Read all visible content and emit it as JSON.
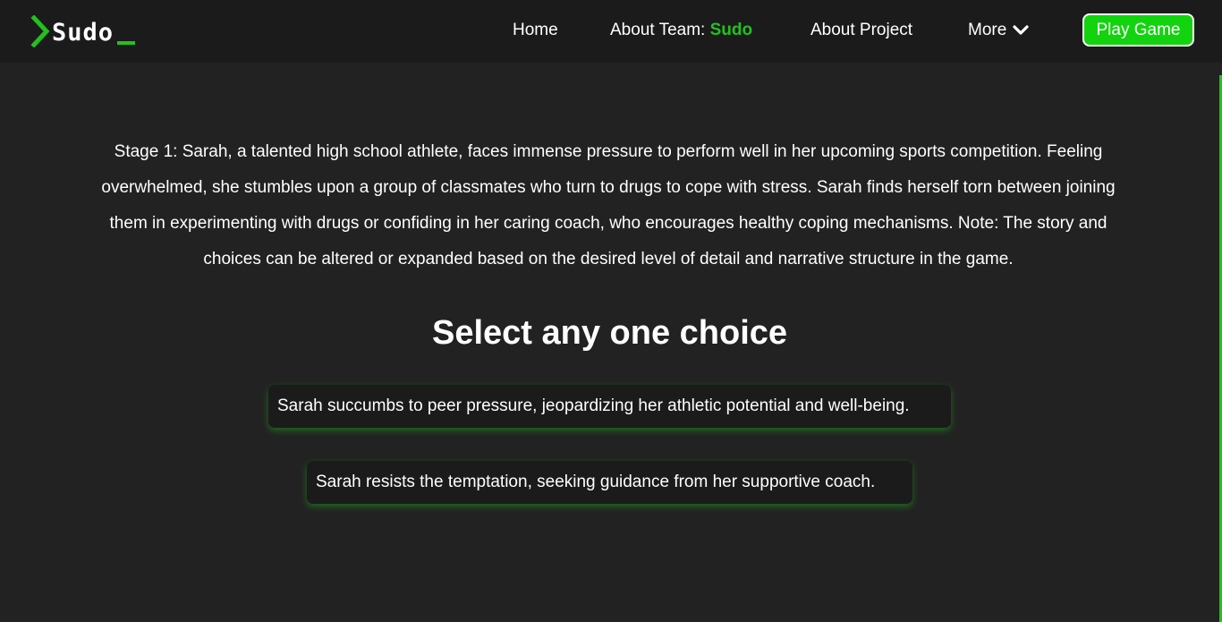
{
  "brand": {
    "logo_text": "Sudo",
    "accent_color": "#22c11e"
  },
  "nav": {
    "home": "Home",
    "about_team_label": "About Team: ",
    "about_team_name": "Sudo",
    "about_project": "About Project",
    "more": "More",
    "more_icon": "chevron-down-icon",
    "play_game": "Play Game",
    "play_game_color": "#12d40e"
  },
  "main": {
    "story": "Stage 1: Sarah, a talented high school athlete, faces immense pressure to perform well in her upcoming sports competition. Feeling overwhelmed, she stumbles upon a group of classmates who turn to drugs to cope with stress. Sarah finds herself torn between joining them in experimenting with drugs or confiding in her caring coach, who encourages healthy coping mechanisms. Note: The story and choices can be altered or expanded based on the desired level of detail and narrative structure in the game.",
    "heading": "Select any one choice",
    "choices": [
      {
        "label": "Sarah succumbs to peer pressure, jeopardizing her athletic potential and well-being."
      },
      {
        "label": "Sarah resists the temptation, seeking guidance from her supportive coach."
      }
    ]
  }
}
